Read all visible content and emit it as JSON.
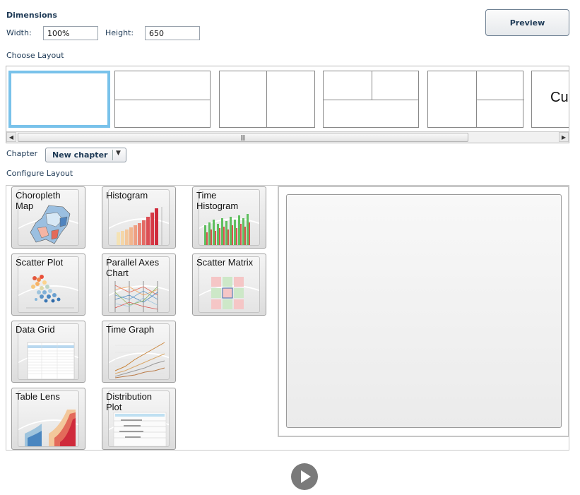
{
  "dimensions": {
    "title": "Dimensions",
    "width_label": "Width:",
    "width_value": "100%",
    "height_label": "Height:",
    "height_value": "650"
  },
  "preview_button": "Preview",
  "choose_layout": {
    "title": "Choose Layout",
    "custom_label": "Cu",
    "selected_index": 0
  },
  "chapter": {
    "label": "Chapter",
    "selected": "New chapter"
  },
  "configure_layout": {
    "title": "Configure Layout",
    "tiles": [
      {
        "label": "Choropleth Map",
        "icon": "choropleth-map-icon"
      },
      {
        "label": "Histogram",
        "icon": "histogram-icon"
      },
      {
        "label": "Time Histogram",
        "icon": "time-histogram-icon"
      },
      {
        "label": "Scatter Plot",
        "icon": "scatter-plot-icon"
      },
      {
        "label": "Parallel Axes Chart",
        "icon": "parallel-axes-icon"
      },
      {
        "label": "Scatter Matrix",
        "icon": "scatter-matrix-icon"
      },
      {
        "label": "Data Grid",
        "icon": "data-grid-icon"
      },
      {
        "label": "Time Graph",
        "icon": "time-graph-icon"
      },
      {
        "label": "Table Lens",
        "icon": "table-lens-icon"
      },
      {
        "label": "Distribution Plot",
        "icon": "distribution-plot-icon"
      }
    ]
  },
  "play_button_icon": "play-icon",
  "colors": {
    "accent_selected": "#79c2ea",
    "text": "#1e3a56"
  }
}
